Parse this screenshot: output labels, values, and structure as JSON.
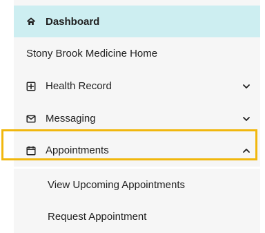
{
  "sidebar": {
    "items": [
      {
        "label": "Dashboard",
        "icon": "home-icon"
      },
      {
        "label": "Stony Brook Medicine Home"
      },
      {
        "label": "Health Record",
        "icon": "health-record-icon",
        "chevron": "chevron-down-icon"
      },
      {
        "label": "Messaging",
        "icon": "mail-icon",
        "chevron": "chevron-down-icon"
      },
      {
        "label": "Appointments",
        "icon": "calendar-icon",
        "chevron": "chevron-up-icon"
      }
    ],
    "appointments_submenu": [
      {
        "label": "View Upcoming Appointments"
      },
      {
        "label": "Request Appointment"
      }
    ]
  },
  "colors": {
    "active_bg": "#cdeef1",
    "menu_bg": "#f6f6f6",
    "highlight": "#f1b70d",
    "text": "#1f1f1f"
  }
}
